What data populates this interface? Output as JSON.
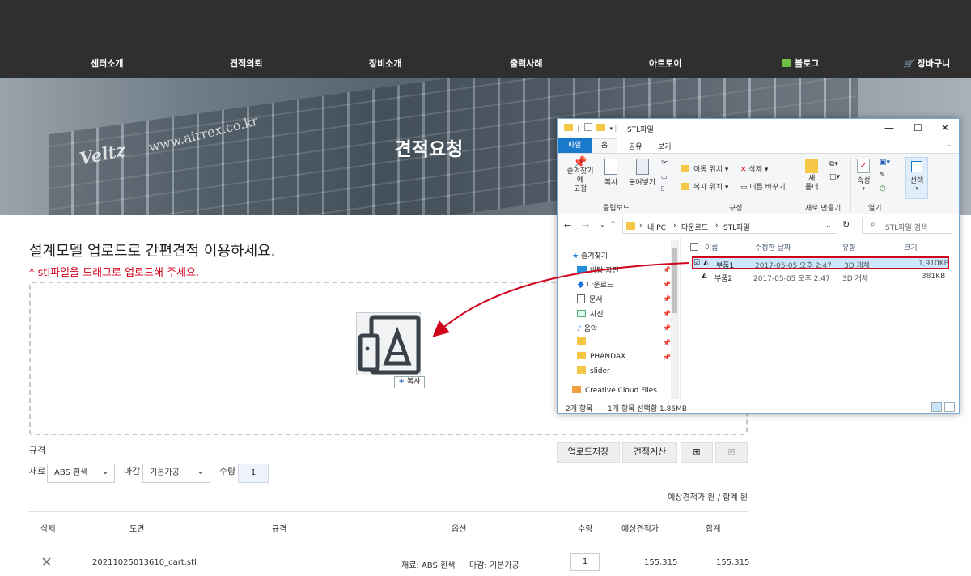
{
  "nav": {
    "items": [
      "센터소개",
      "견적의뢰",
      "장비소개",
      "출력사례",
      "아트토이"
    ],
    "blog": "블로그",
    "cart": "장바구니"
  },
  "hero": {
    "title": "견적요청",
    "building_brand": "Veltz",
    "building_url": "www.airrex.co.kr"
  },
  "upload": {
    "intro": "설계모델 업로드로 간편견적 이용하세요.",
    "hint": "* stl파일을 드래그로 업로드해 주세요.",
    "copy_tag_plus": "+",
    "copy_tag_label": "복사"
  },
  "explorer": {
    "title": "STL파일",
    "tabs": [
      "파일",
      "홈",
      "공유",
      "보기"
    ],
    "ribbon": {
      "pin": "즐겨찾기에\n고정",
      "copy": "복사",
      "paste": "붙여넣기",
      "clipboard_group": "클립보드",
      "move_to": "이동 위치",
      "copy_to": "복사 위치",
      "delete": "삭제",
      "rename": "이름 바꾸기",
      "organize_group": "구성",
      "new_folder": "새\n폴더",
      "new_group": "새로 만들기",
      "properties": "속성",
      "open_group": "열기",
      "select": "선택"
    },
    "breadcrumb": [
      "내 PC",
      "다운로드",
      "STL파일"
    ],
    "search_placeholder": "STL파일 검색",
    "nav_items": [
      {
        "label": "즐겨찾기",
        "type": "star"
      },
      {
        "label": "바탕 화면",
        "type": "desktop",
        "pinned": true
      },
      {
        "label": "다운로드",
        "type": "download",
        "pinned": true
      },
      {
        "label": "문서",
        "type": "doc",
        "pinned": true
      },
      {
        "label": "사진",
        "type": "pic",
        "pinned": true
      },
      {
        "label": "음악",
        "type": "music",
        "pinned": true
      },
      {
        "label": "",
        "type": "folder",
        "pinned": true
      },
      {
        "label": "PHANDAX",
        "type": "folder",
        "pinned": true
      },
      {
        "label": "slider",
        "type": "folder"
      },
      {
        "label": "Creative Cloud Files",
        "type": "cc"
      }
    ],
    "columns": [
      "이름",
      "수정한 날짜",
      "유형",
      "크기"
    ],
    "files": [
      {
        "name": "부품1",
        "date": "2017-05-05 오후 2:47",
        "type": "3D 개체",
        "size": "1,910KB",
        "selected": true
      },
      {
        "name": "부품2",
        "date": "2017-05-05 오후 2:47",
        "type": "3D 개체",
        "size": "381KB",
        "selected": false
      }
    ],
    "status_count": "2개 항목",
    "status_selected": "1개 항목 선택함 1.86MB"
  },
  "spec": {
    "label": "규격",
    "material_label": "재료",
    "material_value": "ABS 흰색",
    "finish_label": "마감",
    "finish_value": "기본가공",
    "qty_label": "수량",
    "qty_value": "1",
    "btn_save": "업로드저장",
    "btn_calc": "견적계산"
  },
  "totals": {
    "text": "예상견적가  원 / 합계  원"
  },
  "table": {
    "headers": [
      "삭제",
      "도면",
      "규격",
      "옵션",
      "수량",
      "예상견적가",
      "합계"
    ],
    "rows": [
      {
        "delete": "×",
        "file": "20211025013610_cart.stl",
        "material": "재료: ABS 흰색",
        "finish": "마감: 기본가공",
        "qty": "1",
        "estimate": "155,315",
        "total": "155,315"
      }
    ]
  },
  "colors": {
    "accent_red": "#d0021b",
    "header_bg": "#2f2f2f",
    "explorer_blue": "#1979ca"
  }
}
